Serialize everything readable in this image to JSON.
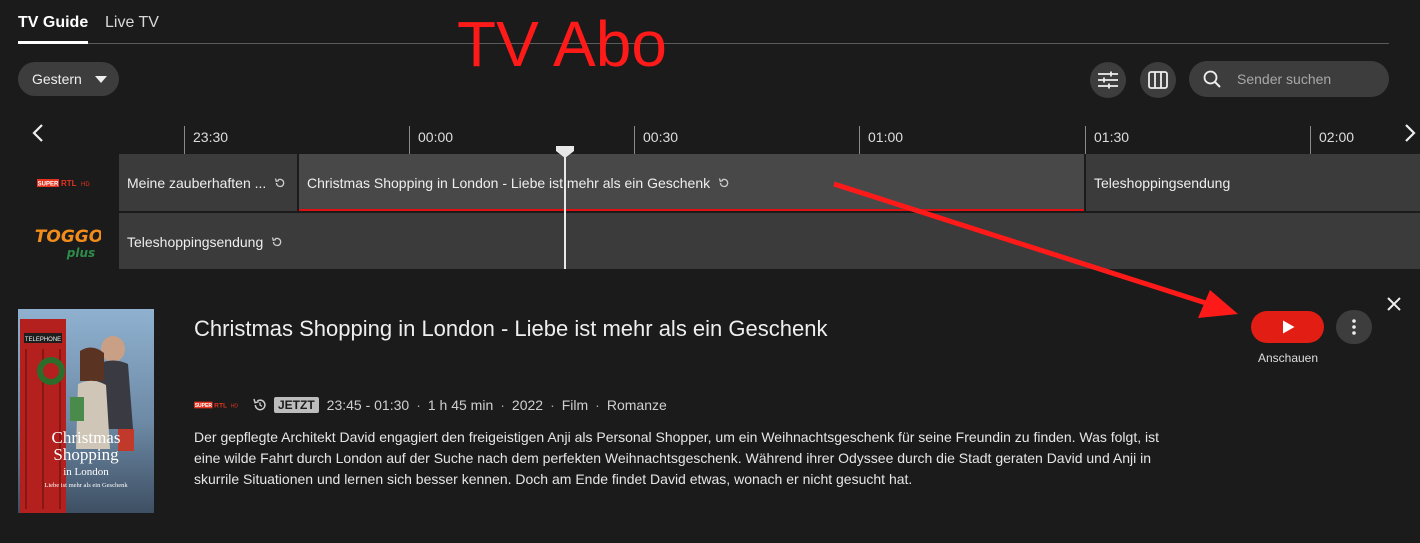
{
  "tabs": [
    {
      "label": "TV Guide",
      "active": true
    },
    {
      "label": "Live TV",
      "active": false
    }
  ],
  "overlay_text": "TV Abo",
  "toolbar": {
    "date_selected": "Gestern",
    "search_placeholder": "Sender suchen",
    "search_value": ""
  },
  "timeline": {
    "ticks": [
      "23:30",
      "00:00",
      "00:30",
      "01:00",
      "01:30",
      "02:00"
    ]
  },
  "channels": [
    {
      "name": "SUPER RTL HD",
      "logo_text": "SUPER RTL HD",
      "programs": [
        {
          "title": "Meine zauberhaften ...",
          "catchup": true
        },
        {
          "title": "Christmas Shopping in London - Liebe ist mehr als ein Geschenk",
          "catchup": true,
          "current": true
        },
        {
          "title": "Teleshoppingsendung",
          "catchup": false
        }
      ]
    },
    {
      "name": "TOGGO plus",
      "logo_text_top": "TOGGO",
      "logo_text_bottom": "plus",
      "programs": [
        {
          "title": "Teleshoppingsendung",
          "catchup": true
        }
      ]
    }
  ],
  "detail": {
    "title": "Christmas Shopping in London - Liebe ist mehr als ein Geschenk",
    "poster": {
      "title_line1": "Christmas",
      "title_line2": "Shopping",
      "title_line3": "in London",
      "subtitle": "Liebe ist mehr als ein Geschenk",
      "sign": "TELEPHONE"
    },
    "channel_logo_text": "SUPER RTL HD",
    "badge": "JETZT",
    "time_range": "23:45 - 01:30",
    "duration": "1 h 45 min",
    "year": "2022",
    "category": "Film",
    "genre": "Romanze",
    "description": "Der gepflegte Architekt David engagiert den freigeistigen Anji als Personal Shopper, um ein Weihnachtsgeschenk für seine Freundin zu finden. Was folgt, ist eine wilde Fahrt durch London auf der Suche nach dem perfekten Weihnachtsgeschenk. Während ihrer Odyssee durch die Stadt geraten David und Anji in skurrile Situationen und lernen sich besser kennen. Doch am Ende findet David etwas, wonach er nicht gesucht hat.",
    "watch_label": "Anschauen"
  },
  "colors": {
    "background": "#1b1b1b",
    "accent_red": "#e21d14",
    "annotation_red": "#ff1a1a",
    "program_bg": "#3b3b3b",
    "current_program_bg": "#484848"
  },
  "icons": [
    "filter-icon",
    "columns-icon",
    "search-icon",
    "chevron-left-icon",
    "chevron-right-icon",
    "replay-icon",
    "play-icon",
    "more-vertical-icon",
    "close-icon",
    "caret-down-icon"
  ]
}
